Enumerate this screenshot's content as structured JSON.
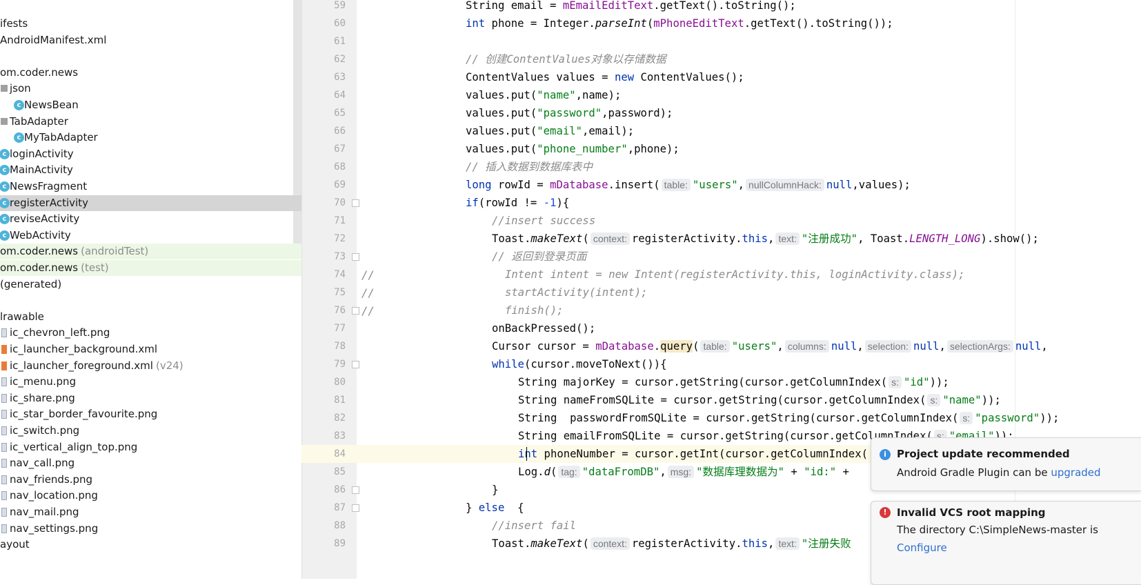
{
  "project_tree": {
    "items": [
      {
        "label": "ifests",
        "suffix": "",
        "icon": "none"
      },
      {
        "label": "AndroidManifest.xml",
        "suffix": "",
        "icon": "none"
      },
      {
        "label": "",
        "suffix": "",
        "icon": "none"
      },
      {
        "label": "om.coder.news",
        "suffix": "",
        "icon": "none"
      },
      {
        "label": "json",
        "suffix": "",
        "icon": "folder-icon"
      },
      {
        "label": "NewsBean",
        "suffix": "",
        "icon": "class-icon"
      },
      {
        "label": "TabAdapter",
        "suffix": "",
        "icon": "folder-icon"
      },
      {
        "label": "MyTabAdapter",
        "suffix": "",
        "icon": "class-icon"
      },
      {
        "label": "loginActivity",
        "suffix": "",
        "icon": "class-icon"
      },
      {
        "label": "MainActivity",
        "suffix": "",
        "icon": "class-icon"
      },
      {
        "label": "NewsFragment",
        "suffix": "",
        "icon": "class-icon"
      },
      {
        "label": "registerActivity",
        "suffix": "",
        "icon": "class-icon"
      },
      {
        "label": "reviseActivity",
        "suffix": "",
        "icon": "class-icon"
      },
      {
        "label": "WebActivity",
        "suffix": "",
        "icon": "class-icon"
      },
      {
        "label": "om.coder.news",
        "suffix": "(androidTest)",
        "icon": "none"
      },
      {
        "label": "om.coder.news",
        "suffix": "(test)",
        "icon": "none"
      },
      {
        "label": "(generated)",
        "suffix": "",
        "icon": "none"
      },
      {
        "label": "",
        "suffix": "",
        "icon": "none"
      },
      {
        "label": "lrawable",
        "suffix": "",
        "icon": "none"
      },
      {
        "label": "ic_chevron_left.png",
        "suffix": "",
        "icon": "png-file-icon"
      },
      {
        "label": "ic_launcher_background.xml",
        "suffix": "",
        "icon": "xml-file-icon"
      },
      {
        "label": "ic_launcher_foreground.xml",
        "suffix": "(v24)",
        "icon": "xml-file-icon"
      },
      {
        "label": "ic_menu.png",
        "suffix": "",
        "icon": "png-file-icon"
      },
      {
        "label": "ic_share.png",
        "suffix": "",
        "icon": "png-file-icon"
      },
      {
        "label": "ic_star_border_favourite.png",
        "suffix": "",
        "icon": "png-file-icon"
      },
      {
        "label": "ic_switch.png",
        "suffix": "",
        "icon": "png-file-icon"
      },
      {
        "label": "ic_vertical_align_top.png",
        "suffix": "",
        "icon": "png-file-icon"
      },
      {
        "label": "nav_call.png",
        "suffix": "",
        "icon": "png-file-icon"
      },
      {
        "label": "nav_friends.png",
        "suffix": "",
        "icon": "png-file-icon"
      },
      {
        "label": "nav_location.png",
        "suffix": "",
        "icon": "png-file-icon"
      },
      {
        "label": "nav_mail.png",
        "suffix": "",
        "icon": "png-file-icon"
      },
      {
        "label": "nav_settings.png",
        "suffix": "",
        "icon": "png-file-icon"
      },
      {
        "label": "ayout",
        "suffix": "",
        "icon": "none"
      }
    ],
    "selected_item": "registerActivity"
  },
  "editor": {
    "line_numbers": [
      "59",
      "60",
      "61",
      "62",
      "63",
      "64",
      "65",
      "66",
      "67",
      "68",
      "69",
      "70",
      "71",
      "72",
      "73",
      "74",
      "75",
      "76",
      "77",
      "78",
      "79",
      "80",
      "81",
      "82",
      "83",
      "84",
      "85",
      "86",
      "87",
      "88",
      "89"
    ],
    "current_line": "84",
    "comment_markers": [
      "//",
      "//",
      "//"
    ],
    "lines": {
      "l59": {
        "a": "String email = ",
        "b": "mEmailEditText",
        "c": ".getText().toString();"
      },
      "l60": {
        "kw": "int",
        "a": " phone = Integer.",
        "b": "parseInt",
        "c": "(",
        "d": "mPhoneEditText",
        "e": ".getText().toString());"
      },
      "l62": {
        "a": "// 创建ContentValues对象以存储数据"
      },
      "l63": {
        "a": "ContentValues values = ",
        "kw": "new",
        "b": " ContentValues();"
      },
      "l64": {
        "a": "values.put(",
        "s": "\"name\"",
        "b": ",name);"
      },
      "l65": {
        "a": "values.put(",
        "s": "\"password\"",
        "b": ",password);"
      },
      "l66": {
        "a": "values.put(",
        "s": "\"email\"",
        "b": ",email);"
      },
      "l67": {
        "a": "values.put(",
        "s": "\"phone_number\"",
        "b": ",phone);"
      },
      "l68": {
        "a": "// 插入数据到数据库表中"
      },
      "l69": {
        "kw": "long",
        "a": " rowId = ",
        "f": "mDatabase",
        "b": ".insert(",
        "h1": "table:",
        "s": "\"users\"",
        "c": ",",
        "h2": "nullColumnHack:",
        "kw2": "null",
        "d": ",values);"
      },
      "l70": {
        "kw": "if",
        "a": "(rowId != ",
        "n": "-1",
        "b": "){"
      },
      "l71": {
        "a": "//insert success"
      },
      "l72": {
        "a": "Toast.",
        "m": "makeText",
        "b": "(",
        "h1": "context:",
        "c": "registerActivity.",
        "kw": "this",
        "d": ",",
        "h2": "text:",
        "s": "\"注册成功\"",
        "e": ", Toast.",
        "k": "LENGTH_LONG",
        "g": ").show();"
      },
      "l73": {
        "a": "// 返回到登录页面"
      },
      "l74": {
        "a": "Intent intent = new Intent(registerActivity.this, loginActivity.class);"
      },
      "l75": {
        "a": "startActivity(intent);"
      },
      "l76": {
        "a": "finish();"
      },
      "l77": {
        "a": "onBackPressed();"
      },
      "l78": {
        "a": "Cursor cursor = ",
        "f": "mDatabase",
        "b": ".",
        "q": "query",
        "c": "(",
        "h1": "table:",
        "s": "\"users\"",
        "d": ",",
        "h2": "columns:",
        "kw": "null",
        "e": ",",
        "h3": "selection:",
        "kw2": "null",
        "g": ",",
        "h4": "selectionArgs:",
        "kw3": "null",
        "z": ","
      },
      "l79": {
        "kw": "while",
        "a": "(cursor.moveToNext()){"
      },
      "l80": {
        "a": "String majorKey = cursor.getString(cursor.getColumnIndex(",
        "h": "s:",
        "s": "\"id\"",
        "b": "));"
      },
      "l81": {
        "a": "String nameFromSQLite = cursor.getString(cursor.getColumnIndex(",
        "h": "s:",
        "s": "\"name\"",
        "b": "));"
      },
      "l82": {
        "a": "String  passwordFromSQLite = cursor.getString(cursor.getColumnIndex(",
        "h": "s:",
        "s": "\"password\"",
        "b": "));"
      },
      "l83": {
        "a": "String emailFromSQLite = cursor.getString(cursor.getColumnIndex(",
        "h": "s:",
        "s": "\"email\"",
        "b": "));"
      },
      "l84": {
        "kw": "int",
        "a": " phoneNumber = cursor.getInt(cursor.getColumnIndex("
      },
      "l85": {
        "a": "Log.",
        "m": "d",
        "b": "(",
        "h1": "tag:",
        "s": "\"dataFromDB\"",
        "c": ",",
        "h2": "msg:",
        "s2": "\"数据库理数据为\"",
        "d": " + ",
        "s3": "\"id:\"",
        "e": " +"
      },
      "l86": {
        "a": "}"
      },
      "l87": {
        "a": "} ",
        "kw": "else",
        "b": "  {"
      },
      "l88": {
        "a": "//insert fail"
      },
      "l89": {
        "a": "Toast.",
        "m": "makeText",
        "b": "(",
        "h1": "context:",
        "c": "registerActivity.",
        "kw": "this",
        "d": ",",
        "h2": "text:",
        "s": "\"注册失败"
      }
    }
  },
  "notifications": [
    {
      "title": "Project update recommended",
      "body": "Android Gradle Plugin can be ",
      "link": "upgraded",
      "icon": "info-icon",
      "color": "#3d8fe0"
    },
    {
      "title": "Invalid VCS root mapping",
      "body": "The directory C:\\SimpleNews-master is",
      "link": "Configure",
      "icon": "error-icon",
      "color": "#d9383a"
    }
  ],
  "colors": {
    "keyword": "#0033b3",
    "string": "#067d17",
    "field": "#871094",
    "comment": "#8c8c8c",
    "number": "#1750eb"
  }
}
